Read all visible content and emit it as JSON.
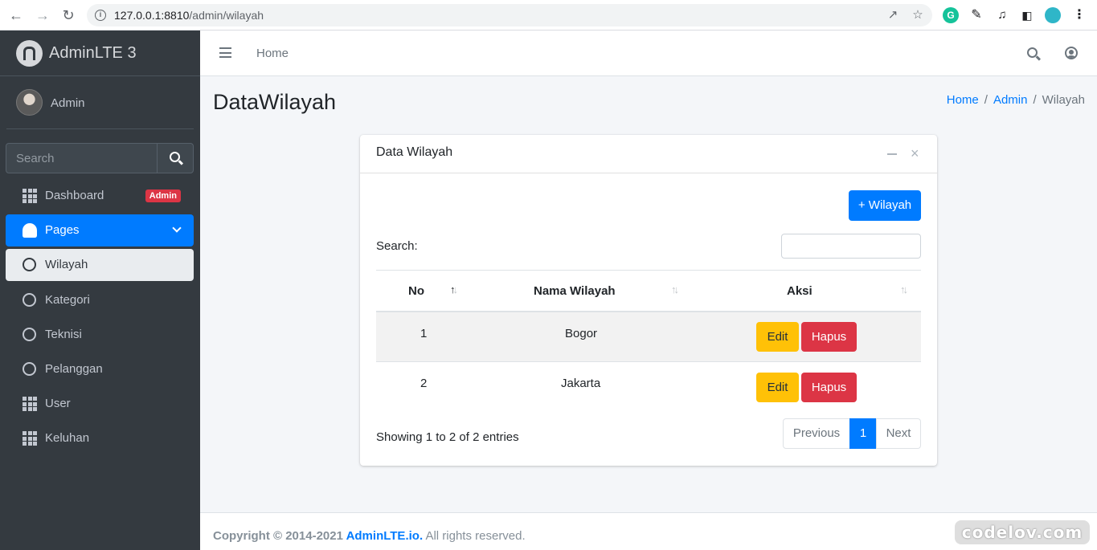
{
  "browser": {
    "url_host": "127.0.0.1:8810",
    "url_path": "/admin/wilayah"
  },
  "sidebar": {
    "brand": "AdminLTE 3",
    "user": "Admin",
    "search_placeholder": "Search",
    "items": [
      {
        "label": "Dashboard",
        "badge": "Admin"
      },
      {
        "label": "Pages"
      },
      {
        "label": "Wilayah"
      },
      {
        "label": "Kategori"
      },
      {
        "label": "Teknisi"
      },
      {
        "label": "Pelanggan"
      },
      {
        "label": "User"
      },
      {
        "label": "Keluhan"
      }
    ]
  },
  "topnav": {
    "home": "Home"
  },
  "page": {
    "title": "DataWilayah",
    "breadcrumb": [
      "Home",
      "Admin",
      "Wilayah"
    ],
    "breadcrumb_sep": "/"
  },
  "card": {
    "title": "Data Wilayah",
    "close_glyph": "×",
    "add_button": "+ Wilayah",
    "search_label": "Search:",
    "columns": [
      "No",
      "Nama Wilayah",
      "Aksi"
    ],
    "rows": [
      {
        "no": "1",
        "nama": "Bogor"
      },
      {
        "no": "2",
        "nama": "Jakarta"
      }
    ],
    "edit_label": "Edit",
    "delete_label": "Hapus",
    "info": "Showing 1 to 2 of 2 entries",
    "pager": {
      "prev": "Previous",
      "page": "1",
      "next": "Next"
    }
  },
  "footer": {
    "copyright": "Copyright © 2014-2021 ",
    "link": "AdminLTE.io.",
    "rest": " All rights reserved."
  },
  "watermark": "codelov.com",
  "colors": {
    "primary": "#007bff",
    "warning": "#ffc107",
    "danger": "#dc3545",
    "sidebar": "#343a40"
  }
}
